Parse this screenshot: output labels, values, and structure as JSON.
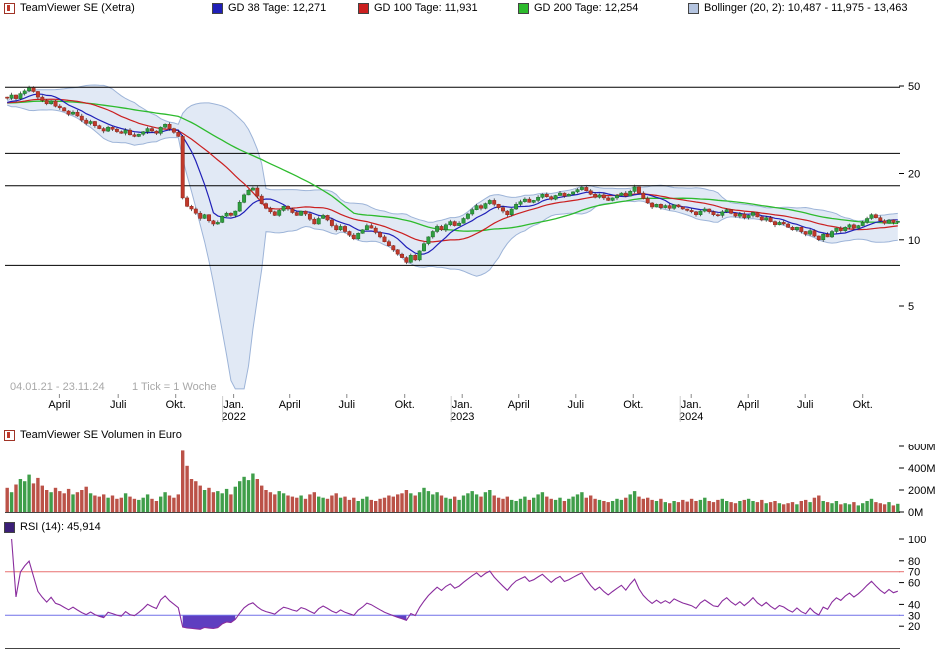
{
  "legend": {
    "instrument": "TeamViewer SE (Xetra)",
    "gd38": "GD 38 Tage: 12,271",
    "gd100": "GD 100 Tage: 11,931",
    "gd200": "GD 200 Tage: 12,254",
    "bollinger": "Bollinger (20, 2): 10,487 - 11,975 - 13,463"
  },
  "volume_legend": "TeamViewer SE Volumen in Euro",
  "rsi_legend": "RSI (14): 45,914",
  "colors": {
    "up": "#2f9e3f",
    "up_border": "#1b6e28",
    "down": "#c0392b",
    "down_border": "#8e251a",
    "gd38": "#2020b8",
    "gd100": "#cc2020",
    "gd200": "#2dbb2d",
    "boll_fill": "#c9d7ec",
    "boll_stroke": "#9db4d8",
    "boll_icon": "#b4c4e0",
    "vol_up": "#3f9e4a",
    "vol_down": "#bb5248",
    "vol_icon": "#c0504d",
    "rsi": "#8a2d9e",
    "rsi_fill": "#5f3ec0",
    "rsi_icon": "#3b1f77",
    "rsi_hi": "#e87070",
    "rsi_lo": "#7070e8",
    "axis": "#000000",
    "note": "#a8a8a8"
  },
  "chart_data": [
    {
      "type": "candlestick",
      "title": "TeamViewer SE (Xetra)",
      "date_range": "04.01.21 - 23.11.24",
      "tick_note": "1 Tick = 1 Woche",
      "y_scale": "log",
      "ylim": [
        2.0,
        98
      ],
      "y_ticks": [
        50,
        20,
        10,
        5
      ],
      "hlines": [
        49.4,
        24.7,
        17.6,
        7.65
      ],
      "x_axis": [
        {
          "label": "April",
          "week": 11.9
        },
        {
          "label": "Juli",
          "week": 25.3
        },
        {
          "label": "Okt.",
          "week": 38.4
        },
        {
          "label": "Jan.",
          "week": 51.6,
          "year": "2022"
        },
        {
          "label": "April",
          "week": 64.4
        },
        {
          "label": "Juli",
          "week": 77.4
        },
        {
          "label": "Okt.",
          "week": 90.6
        },
        {
          "label": "Jan.",
          "week": 103.7,
          "year": "2023"
        },
        {
          "label": "April",
          "week": 116.6
        },
        {
          "label": "Juli",
          "week": 129.6
        },
        {
          "label": "Okt.",
          "week": 142.7
        },
        {
          "label": "Jan.",
          "week": 155.9,
          "year": "2024"
        },
        {
          "label": "April",
          "week": 168.9
        },
        {
          "label": "Juli",
          "week": 181.9
        },
        {
          "label": "Okt.",
          "week": 195.0
        }
      ],
      "overlays": [
        {
          "name": "GD 38 Tage",
          "window_weeks": 8,
          "last_value": "12,271",
          "color_key": "gd38"
        },
        {
          "name": "GD 100 Tage",
          "window_weeks": 20,
          "last_value": "11,931",
          "color_key": "gd100"
        },
        {
          "name": "GD 200 Tage",
          "window_weeks": 40,
          "last_value": "12,254",
          "color_key": "gd200"
        },
        {
          "name": "Bollinger (20, 2)",
          "window_weeks": 20,
          "mult": 2,
          "last_values": "10,487 - 11,975 - 13,463",
          "color_key": "boll_stroke"
        }
      ],
      "closes": [
        44.0,
        45.5,
        43.8,
        46.2,
        47.5,
        49.0,
        47.2,
        44.5,
        43.0,
        41.5,
        42.8,
        40.5,
        39.8,
        38.5,
        37.2,
        38.0,
        36.5,
        35.0,
        33.8,
        34.5,
        33.0,
        32.0,
        31.2,
        32.5,
        31.8,
        31.0,
        30.5,
        31.5,
        30.0,
        29.5,
        30.2,
        31.0,
        32.0,
        31.2,
        30.5,
        32.5,
        33.5,
        32.0,
        30.8,
        29.5,
        15.5,
        14.2,
        13.8,
        13.2,
        12.5,
        13.0,
        12.2,
        11.8,
        12.0,
        12.8,
        13.2,
        12.9,
        13.5,
        14.8,
        16.0,
        16.8,
        17.2,
        15.8,
        14.6,
        13.9,
        13.4,
        12.9,
        13.6,
        14.2,
        13.8,
        13.3,
        12.9,
        13.5,
        13.1,
        12.4,
        11.8,
        12.5,
        12.9,
        12.3,
        11.6,
        11.1,
        11.5,
        10.9,
        10.5,
        10.1,
        10.7,
        11.1,
        11.6,
        11.3,
        10.8,
        10.3,
        9.8,
        9.4,
        9.0,
        8.6,
        8.3,
        7.9,
        8.5,
        8.1,
        8.9,
        9.6,
        10.3,
        10.9,
        11.5,
        11.1,
        11.7,
        12.1,
        11.6,
        11.9,
        12.5,
        13.1,
        13.7,
        14.3,
        13.9,
        14.6,
        15.1,
        14.5,
        14.0,
        13.5,
        13.0,
        13.8,
        14.5,
        14.9,
        15.3,
        14.8,
        15.1,
        15.6,
        16.1,
        15.7,
        15.3,
        15.9,
        16.3,
        15.8,
        16.1,
        16.5,
        16.9,
        17.3,
        16.7,
        16.1,
        15.6,
        16.0,
        15.5,
        15.1,
        15.5,
        15.9,
        16.3,
        15.8,
        16.6,
        17.4,
        16.3,
        15.4,
        14.7,
        14.1,
        14.5,
        14.0,
        14.3,
        13.9,
        14.4,
        14.1,
        13.8,
        13.6,
        13.4,
        13.0,
        13.5,
        13.8,
        13.4,
        13.0,
        12.9,
        13.4,
        13.7,
        13.2,
        12.8,
        13.1,
        12.6,
        12.9,
        13.3,
        12.7,
        12.3,
        12.6,
        12.1,
        11.7,
        12.0,
        11.8,
        11.4,
        11.1,
        11.4,
        10.9,
        10.6,
        11.0,
        10.4,
        10.0,
        10.6,
        10.3,
        10.9,
        11.3,
        11.0,
        11.4,
        11.7,
        11.3,
        11.6,
        12.0,
        12.5,
        13.0,
        12.6,
        12.2,
        11.9,
        12.3,
        12.0,
        12.15
      ]
    },
    {
      "type": "bar",
      "title": "TeamViewer SE Volumen in Euro",
      "unit": "M",
      "ylim": [
        0,
        600
      ],
      "y_ticks": [
        {
          "v": 600,
          "label": "600M"
        },
        {
          "v": 400,
          "label": "400M"
        },
        {
          "v": 200,
          "label": "200M"
        },
        {
          "v": 0,
          "label": "0M"
        }
      ],
      "values": [
        220,
        180,
        250,
        300,
        280,
        340,
        260,
        310,
        240,
        200,
        180,
        220,
        190,
        170,
        210,
        160,
        180,
        200,
        230,
        170,
        150,
        140,
        160,
        130,
        150,
        120,
        130,
        170,
        140,
        120,
        110,
        130,
        160,
        120,
        100,
        140,
        180,
        150,
        130,
        160,
        560,
        420,
        300,
        280,
        240,
        200,
        220,
        180,
        190,
        170,
        210,
        160,
        230,
        280,
        320,
        290,
        350,
        300,
        240,
        200,
        180,
        160,
        190,
        170,
        150,
        140,
        130,
        150,
        120,
        160,
        180,
        140,
        130,
        120,
        150,
        170,
        130,
        140,
        110,
        130,
        100,
        120,
        140,
        110,
        100,
        120,
        130,
        150,
        140,
        160,
        170,
        200,
        170,
        150,
        180,
        220,
        190,
        160,
        180,
        150,
        130,
        120,
        140,
        110,
        150,
        170,
        190,
        160,
        140,
        180,
        200,
        150,
        130,
        120,
        140,
        110,
        100,
        120,
        140,
        110,
        130,
        160,
        180,
        140,
        120,
        110,
        130,
        100,
        120,
        140,
        160,
        180,
        130,
        150,
        120,
        110,
        100,
        90,
        100,
        120,
        110,
        130,
        160,
        190,
        140,
        120,
        130,
        110,
        100,
        120,
        90,
        80,
        100,
        90,
        110,
        95,
        120,
        100,
        110,
        130,
        100,
        90,
        110,
        120,
        100,
        90,
        80,
        100,
        110,
        120,
        100,
        90,
        110,
        80,
        90,
        100,
        80,
        70,
        80,
        90,
        70,
        100,
        110,
        90,
        130,
        150,
        100,
        90,
        80,
        100,
        70,
        80,
        70,
        90,
        60,
        80,
        100,
        120,
        90,
        80,
        70,
        90,
        60,
        75
      ]
    },
    {
      "type": "line",
      "title": "RSI (14)",
      "last_value": "45,914",
      "period": 14,
      "source": "closes",
      "ylim": [
        0,
        100
      ],
      "y_ticks": [
        100,
        80,
        60,
        40,
        20
      ],
      "hlines": [
        {
          "v": 70,
          "label": "70",
          "color_key": "rsi_hi"
        },
        {
          "v": 30,
          "label": "30",
          "color_key": "rsi_lo"
        }
      ]
    }
  ]
}
